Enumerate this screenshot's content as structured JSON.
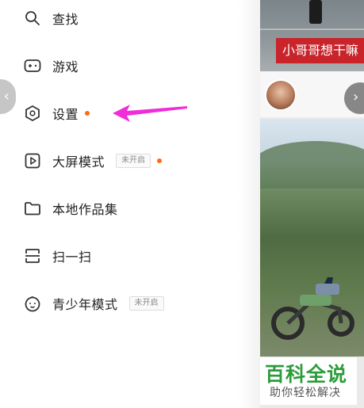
{
  "menu": {
    "items": [
      {
        "key": "search",
        "label": "查找",
        "icon": "search-icon"
      },
      {
        "key": "games",
        "label": "游戏",
        "icon": "gamepad-icon"
      },
      {
        "key": "settings",
        "label": "设置",
        "icon": "settings-hexagon-icon",
        "dot": true
      },
      {
        "key": "big-screen",
        "label": "大屏模式",
        "icon": "play-square-icon",
        "tag": "未开启",
        "dot": true
      },
      {
        "key": "local-works",
        "label": "本地作品集",
        "icon": "folder-icon"
      },
      {
        "key": "scan",
        "label": "扫一扫",
        "icon": "scan-icon"
      },
      {
        "key": "teen-mode",
        "label": "青少年模式",
        "icon": "child-face-icon",
        "tag": "未开启"
      }
    ]
  },
  "feed": {
    "top_card_caption": "小哥哥想干嘛"
  },
  "watermark": {
    "main": "百科全说",
    "sub": "助你轻松解决"
  },
  "colors": {
    "accent_dot": "#ff6a13",
    "arrow": "#ee2fd9",
    "caption_bg": "#c8242a",
    "logo_green": "#2c9c3a"
  }
}
